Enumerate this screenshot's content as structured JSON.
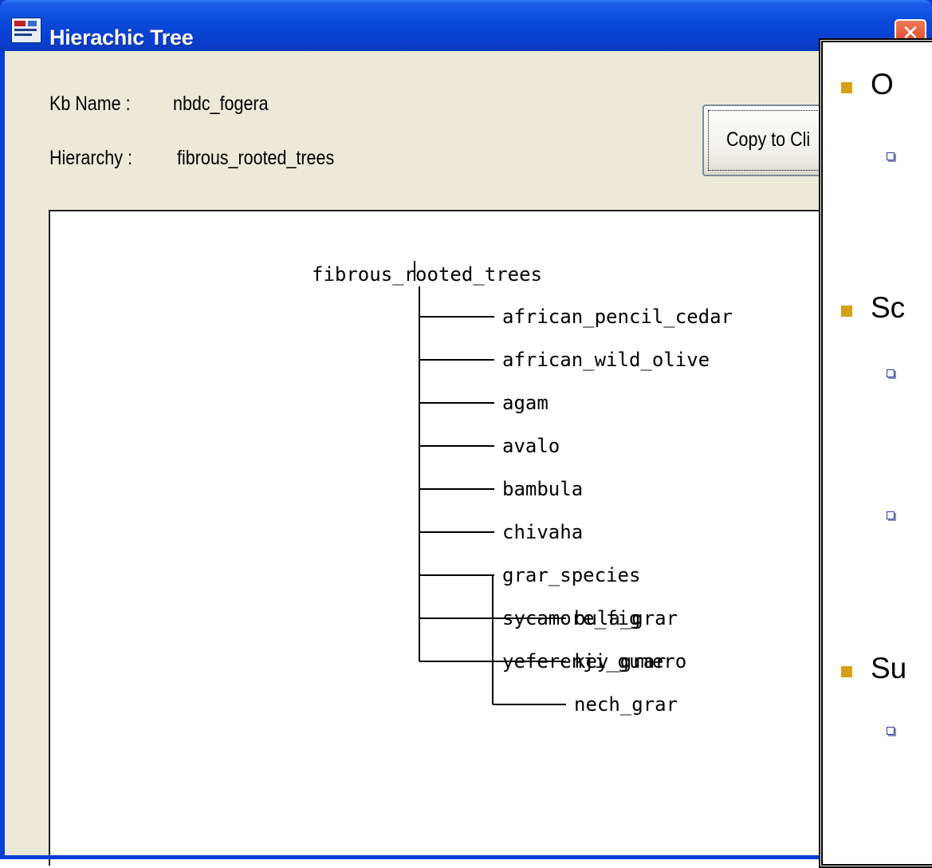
{
  "window": {
    "title": "Hierachic Tree",
    "close_glyph": "✕"
  },
  "fields": {
    "kb_label": "Kb Name :",
    "kb_value": "nbdc_fogera",
    "hierarchy_label": "Hierarchy :",
    "hierarchy_value": "fibrous_rooted_trees"
  },
  "copy_button": {
    "label": "Copy to Cli"
  },
  "tree": {
    "root": "fibrous_rooted_trees",
    "children": [
      {
        "label": "african_pencil_cedar"
      },
      {
        "label": "african_wild_olive"
      },
      {
        "label": "agam"
      },
      {
        "label": "avalo"
      },
      {
        "label": "bambula"
      },
      {
        "label": "chivaha"
      },
      {
        "label": "grar_species",
        "children": [
          {
            "label": "bula_grar"
          },
          {
            "label": "key_grar"
          },
          {
            "label": "nech_grar"
          }
        ]
      },
      {
        "label": "sycamore_fig"
      },
      {
        "label": "yeferenji_gumero"
      }
    ]
  },
  "overlay": {
    "items": [
      {
        "type": "bullet",
        "text": "O"
      },
      {
        "type": "sub",
        "text": ""
      },
      {
        "type": "bullet",
        "text": "Sc"
      },
      {
        "type": "sub",
        "text": ""
      },
      {
        "type": "sub",
        "text": ""
      },
      {
        "type": "bullet",
        "text": "Su"
      },
      {
        "type": "sub",
        "text": ""
      }
    ],
    "bullet_color": "#d4a017"
  },
  "colors": {
    "titlebar": "#0a48d8",
    "dialog_bg": "#ece9d8",
    "close_button": "#d6401d"
  }
}
